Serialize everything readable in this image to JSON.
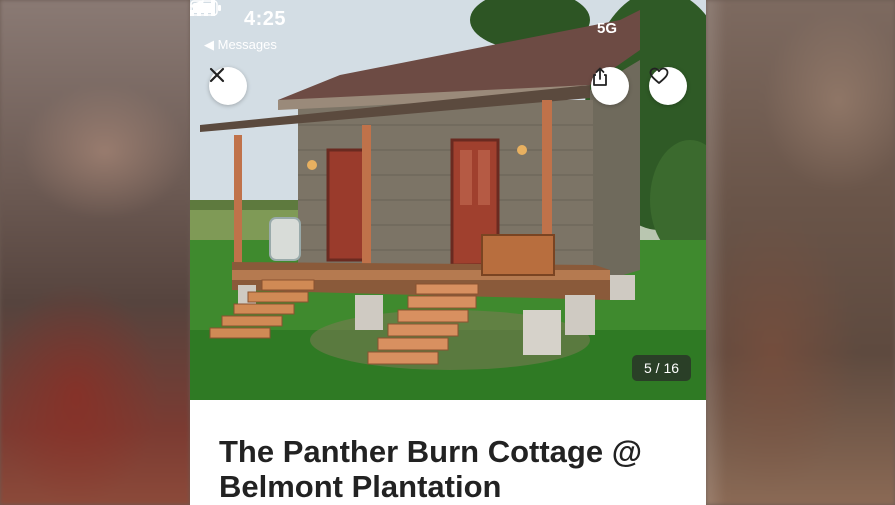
{
  "status_bar": {
    "time": "4:25",
    "back_label": "◀ Messages",
    "network": "5G",
    "icons": [
      "location-arrow-icon",
      "signal-bars-icon",
      "battery-icon"
    ]
  },
  "photo": {
    "counter": "5 / 16",
    "description_icons": [
      "close-icon",
      "share-icon",
      "heart-icon"
    ]
  },
  "listing": {
    "title_line1": "The Panther Burn Cottage @",
    "title_line2": "Belmont Plantation"
  },
  "colors": {
    "title": "#222222",
    "counter_bg": "#3a3a3a",
    "button_bg": "#ffffff"
  }
}
